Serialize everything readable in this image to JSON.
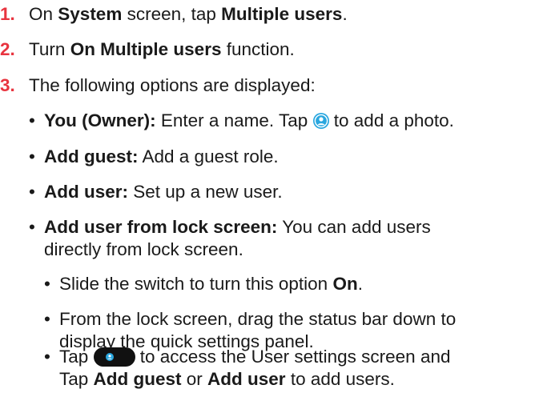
{
  "steps": [
    {
      "num": "1.",
      "t1": "On ",
      "b1": "System",
      "t2": " screen, tap ",
      "b2": "Multiple users",
      "t3": "."
    },
    {
      "num": "2.",
      "t1": "Turn ",
      "b1": "On Multiple users",
      "t2": " function."
    },
    {
      "num": "3.",
      "t1": "The following options are displayed:"
    }
  ],
  "options": [
    {
      "bold": "You (Owner):",
      "text_before_icon": " Enter a name. Tap ",
      "icon": "user-avatar-icon",
      "text_after_icon": " to add a photo."
    },
    {
      "bold": "Add guest:",
      "text": " Add a guest role."
    },
    {
      "bold": "Add user:",
      "text": " Set up a new user."
    },
    {
      "bold": "Add user from lock screen:",
      "text": " You can add users",
      "text_line2": "directly from lock screen."
    }
  ],
  "sub_options": [
    {
      "t1": "Slide the switch to turn this option ",
      "b1": "On",
      "t2": "."
    },
    {
      "line1": "From the lock screen, drag the status bar down to",
      "line2": "display the quick settings panel."
    },
    {
      "t1": "Tap ",
      "icon": "user-toggle-icon",
      "t2": " to access the User settings screen and",
      "l2_t1": "Tap ",
      "l2_b1": "Add guest",
      "l2_t2": " or ",
      "l2_b2": "Add user",
      "l2_t3": " to add users."
    }
  ],
  "bullet_char": "•",
  "colors": {
    "step_number": "#e8343f",
    "icon_accent": "#2aa7df",
    "toggle_bg": "#111111"
  }
}
